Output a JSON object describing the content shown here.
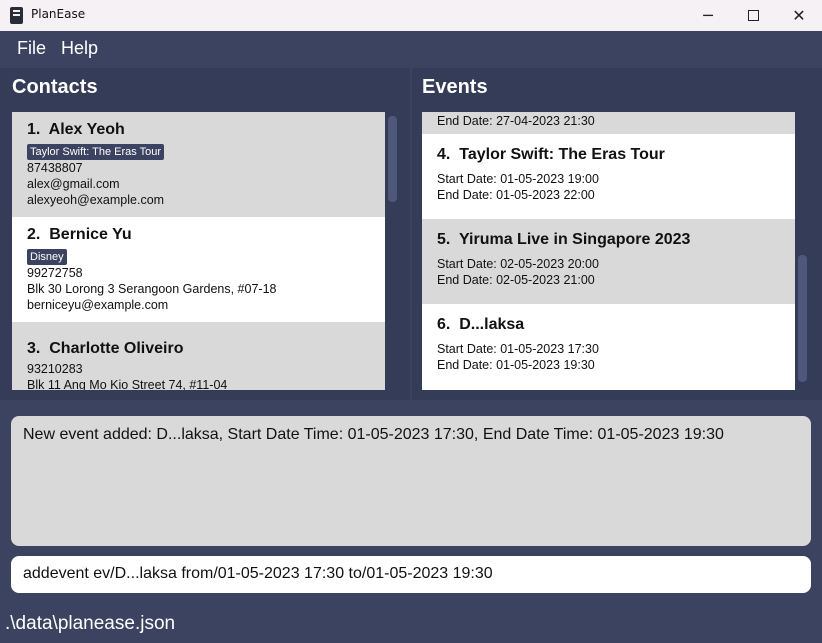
{
  "window": {
    "title": "PlanEase",
    "minimize_glyph": "─",
    "close_glyph": "✕"
  },
  "menu": {
    "file": "File",
    "help": "Help"
  },
  "contacts": {
    "title": "Contacts",
    "items": [
      {
        "index": "1.",
        "name": "Alex Yeoh",
        "tag": "Taylor Swift: The Eras Tour",
        "phone": "87438807",
        "lines": [
          "alex@gmail.com",
          "alexyeoh@example.com"
        ]
      },
      {
        "index": "2.",
        "name": "Bernice Yu",
        "tag": "Disney",
        "phone": "99272758",
        "lines": [
          "Blk 30 Lorong 3 Serangoon Gardens, #07-18",
          "berniceyu@example.com"
        ]
      },
      {
        "index": "3.",
        "name": "Charlotte Oliveiro",
        "phone": "93210283",
        "lines": [
          "Blk 11 Ang Mo Kio Street 74, #11-04"
        ]
      }
    ]
  },
  "events": {
    "title": "Events",
    "partial_end": "End Date: 27-04-2023 21:30",
    "items": [
      {
        "index": "4.",
        "name": "Taylor Swift: The Eras Tour",
        "start": "Start Date: 01-05-2023 19:00",
        "end": "End Date: 01-05-2023 22:00"
      },
      {
        "index": "5.",
        "name": "Yiruma Live in Singapore 2023",
        "start": "Start Date: 02-05-2023 20:00",
        "end": "End Date: 02-05-2023 21:00"
      },
      {
        "index": "6.",
        "name": "D...laksa",
        "start": "Start Date: 01-05-2023 17:30",
        "end": "End Date: 01-05-2023 19:30"
      }
    ]
  },
  "result": "New event added: D...laksa, Start Date Time: 01-05-2023 17:30, End Date Time: 01-05-2023 19:30",
  "command": "addevent ev/D...laksa from/01-05-2023 17:30 to/01-05-2023 19:30",
  "status": {
    "path": ".\\data\\planease.json"
  },
  "colors": {
    "background": "#3b4360",
    "panel": "#353c57",
    "card_grey": "#d9d9d9",
    "card_white": "#ffffff",
    "tag": "#3b4360"
  }
}
